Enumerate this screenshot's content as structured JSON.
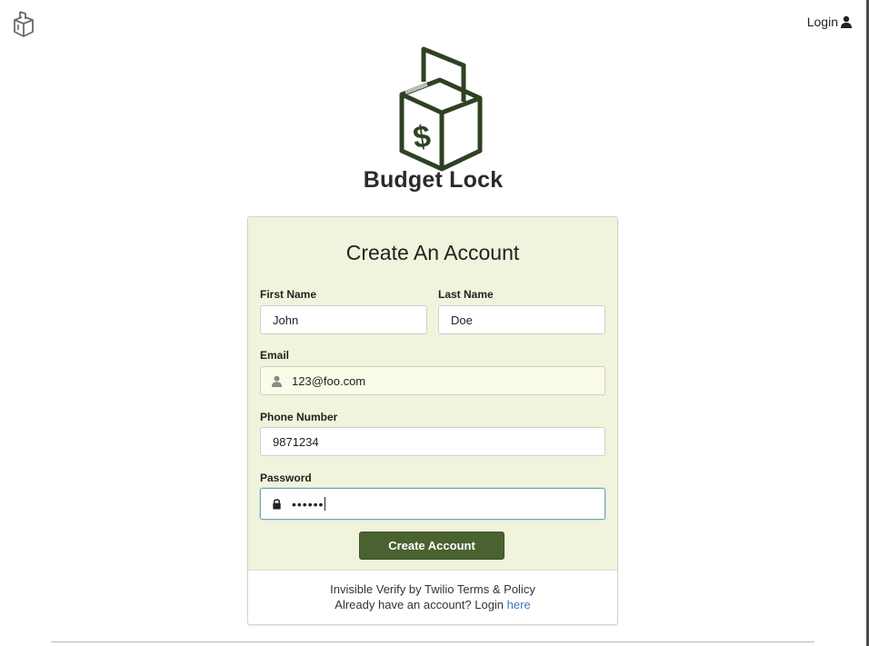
{
  "header": {
    "logo_icon": "ballot-box-icon",
    "login_label": "Login",
    "login_icon": "user-icon"
  },
  "brand": {
    "logo_icon": "ballot-box-dollar-icon",
    "name": "Budget Lock",
    "accent_color": "#2e4223"
  },
  "form": {
    "title": "Create An Account",
    "first_name": {
      "label": "First Name",
      "value": "John"
    },
    "last_name": {
      "label": "Last Name",
      "value": "Doe"
    },
    "email": {
      "label": "Email",
      "value": "123@foo.com",
      "icon": "user-icon"
    },
    "phone": {
      "label": "Phone Number",
      "value": "9871234"
    },
    "password": {
      "label": "Password",
      "masked_value": "••••••",
      "icon": "lock-icon"
    },
    "submit_label": "Create Account",
    "button_color": "#4a6130",
    "card_color": "#f2f3dc"
  },
  "footer": {
    "verify_text": "Invisible Verify by Twilio Terms & Policy",
    "login_prompt": "Already have an account? Login",
    "login_link": "here"
  }
}
